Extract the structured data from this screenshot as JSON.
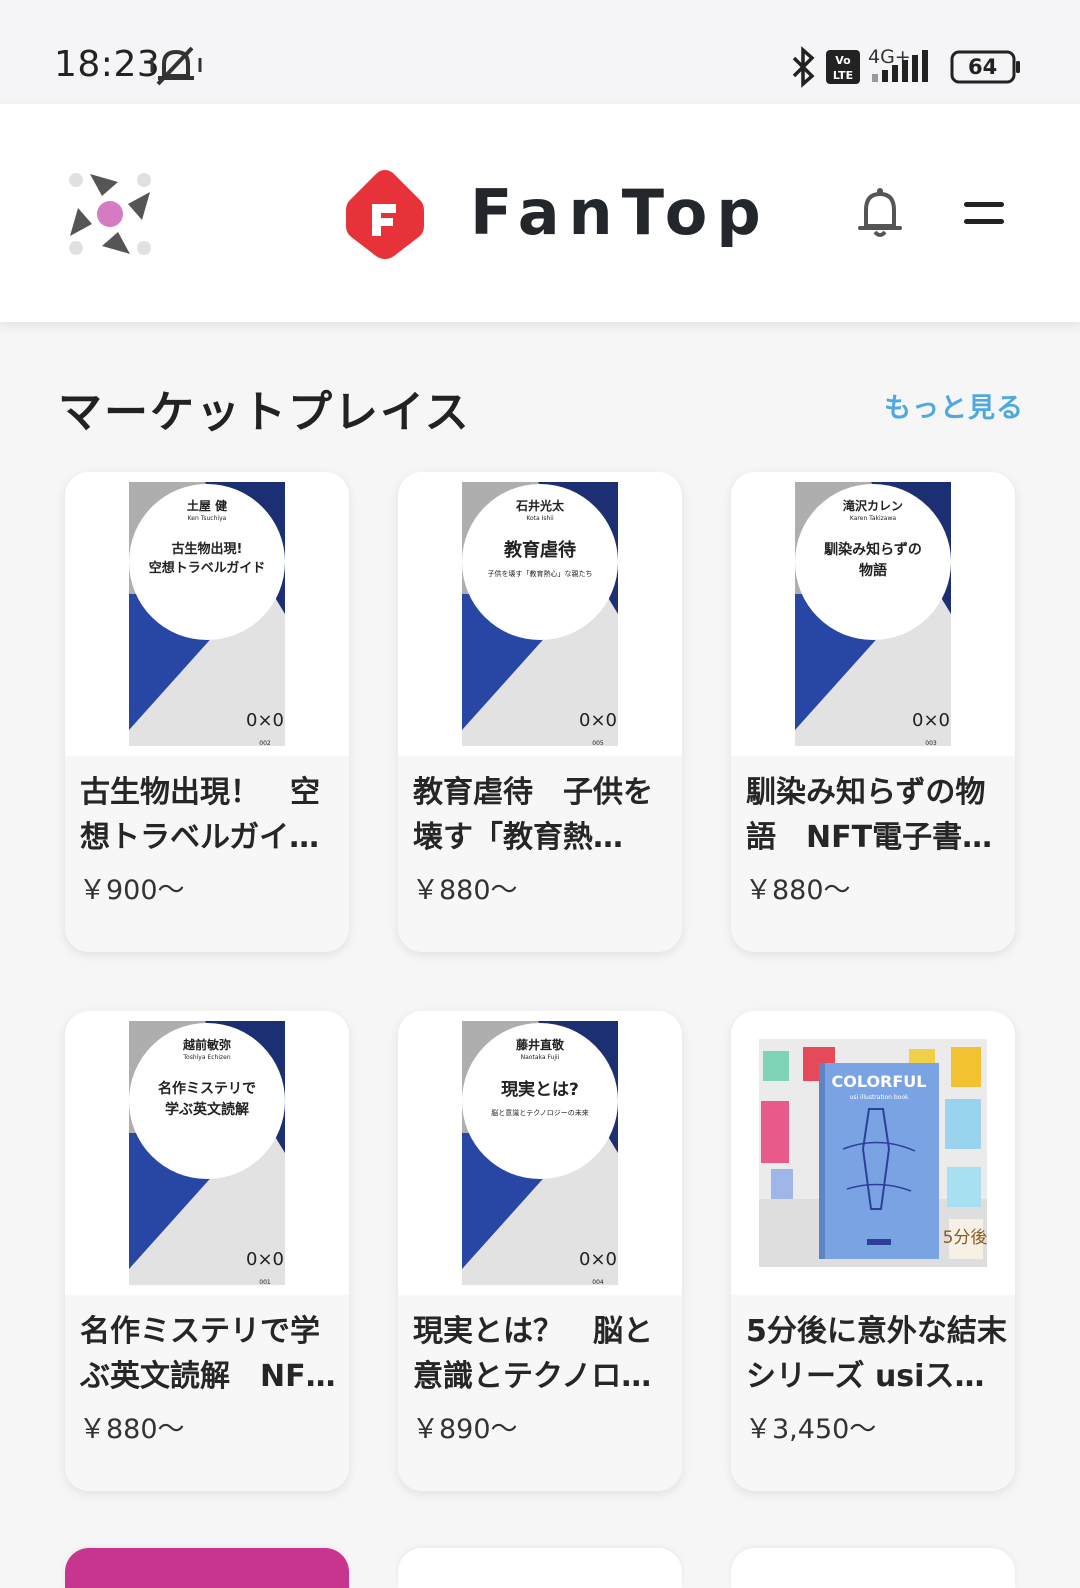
{
  "status_bar": {
    "time": "18:23",
    "network": "4G+",
    "volte": "Vo LTE",
    "battery": "64"
  },
  "header": {
    "brand": "FanTop",
    "icons": [
      "logo-spinner-icon",
      "fantop-logo-icon",
      "bell-icon",
      "menu-icon"
    ]
  },
  "section": {
    "title": "マーケットプレイス",
    "more_label": "もっと見る"
  },
  "products": [
    {
      "title": "古生物出現！　空想トラベルガイド…",
      "price": "￥900〜",
      "cover": {
        "author": "土屋 健",
        "author_en": "Ken Tsuchiya",
        "line1": "古生物出現!",
        "line2": "空想トラベルガイド",
        "number": "002"
      }
    },
    {
      "title": "教育虐待　子供を壊す「教育熱心」…",
      "price": "￥880〜",
      "cover": {
        "author": "石井光太",
        "author_en": "Kota Ishii",
        "line1": "教育虐待",
        "line2": "子供を壊す「教育熱心」な親たち",
        "number": "005"
      }
    },
    {
      "title": "馴染み知らずの物語　NFT電子書籍版",
      "price": "￥880〜",
      "cover": {
        "author": "滝沢カレン",
        "author_en": "Karen Takizawa",
        "line1": "馴染み知らずの",
        "line2": "物語",
        "number": "003"
      }
    },
    {
      "title": "名作ミステリで学ぶ英文読解　NFT…",
      "price": "￥880〜",
      "cover": {
        "author": "越前敏弥",
        "author_en": "Toshiya Echizen",
        "line1": "名作ミステリで",
        "line2": "学ぶ英文読解",
        "number": "001"
      }
    },
    {
      "title": "現実とは？　脳と意識とテクノロジ…",
      "price": "￥890〜",
      "cover": {
        "author": "藤井直敬",
        "author_en": "Naotaka Fujii",
        "line1": "現実とは?",
        "line2": "脳と意識とテクノロジーの未来",
        "number": "004"
      }
    },
    {
      "title": "5分後に意外な結末シリーズ usiスケ…",
      "price": "￥3,450〜",
      "cover": {
        "heading": "COLORFUL",
        "subheading": "usi illustration book",
        "badge": "5分後"
      }
    }
  ],
  "colors": {
    "accent_red": "#e8323a",
    "cover_blue": "#2846a3",
    "cover_navy": "#1d2f73",
    "link_blue": "#4fa9df",
    "partial_card_magenta": "#c8358e"
  }
}
